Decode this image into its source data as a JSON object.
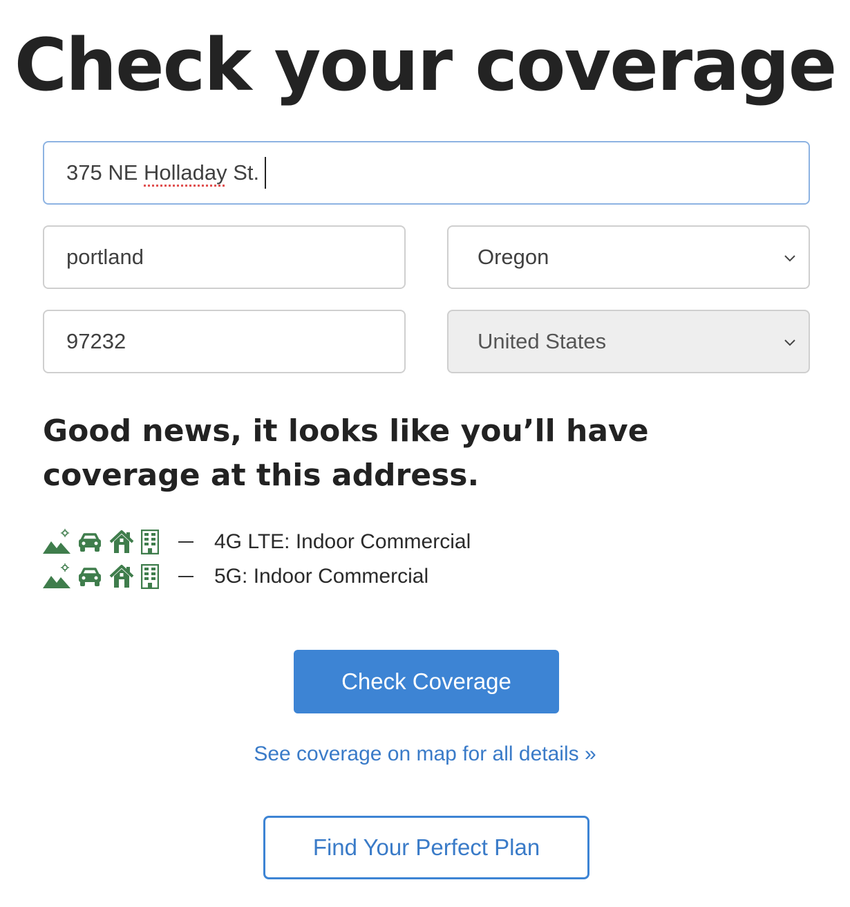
{
  "page": {
    "title": "Check your coverage"
  },
  "form": {
    "address_value_a": "375 NE ",
    "address_value_b": "Holladay",
    "address_value_c": " St.",
    "city_value": "portland",
    "state_value": "Oregon",
    "zip_value": "97232",
    "country_value": "United States"
  },
  "result": {
    "message": "Good news, it looks like you’ll have coverage at this address.",
    "rows": [
      {
        "label": "4G LTE: Indoor Commercial"
      },
      {
        "label": "5G: Indoor Commercial"
      }
    ],
    "icon_names": [
      "landscape-pin-icon",
      "car-icon",
      "house-icon",
      "building-icon"
    ],
    "icon_color": "#3f7d4c"
  },
  "actions": {
    "check_label": "Check Coverage",
    "map_link": "See coverage on map for all details »",
    "plan_label": "Find Your Perfect Plan"
  },
  "colors": {
    "primary": "#3d84d4",
    "link": "#3a7bc8",
    "focus_border": "#8db3e2"
  }
}
